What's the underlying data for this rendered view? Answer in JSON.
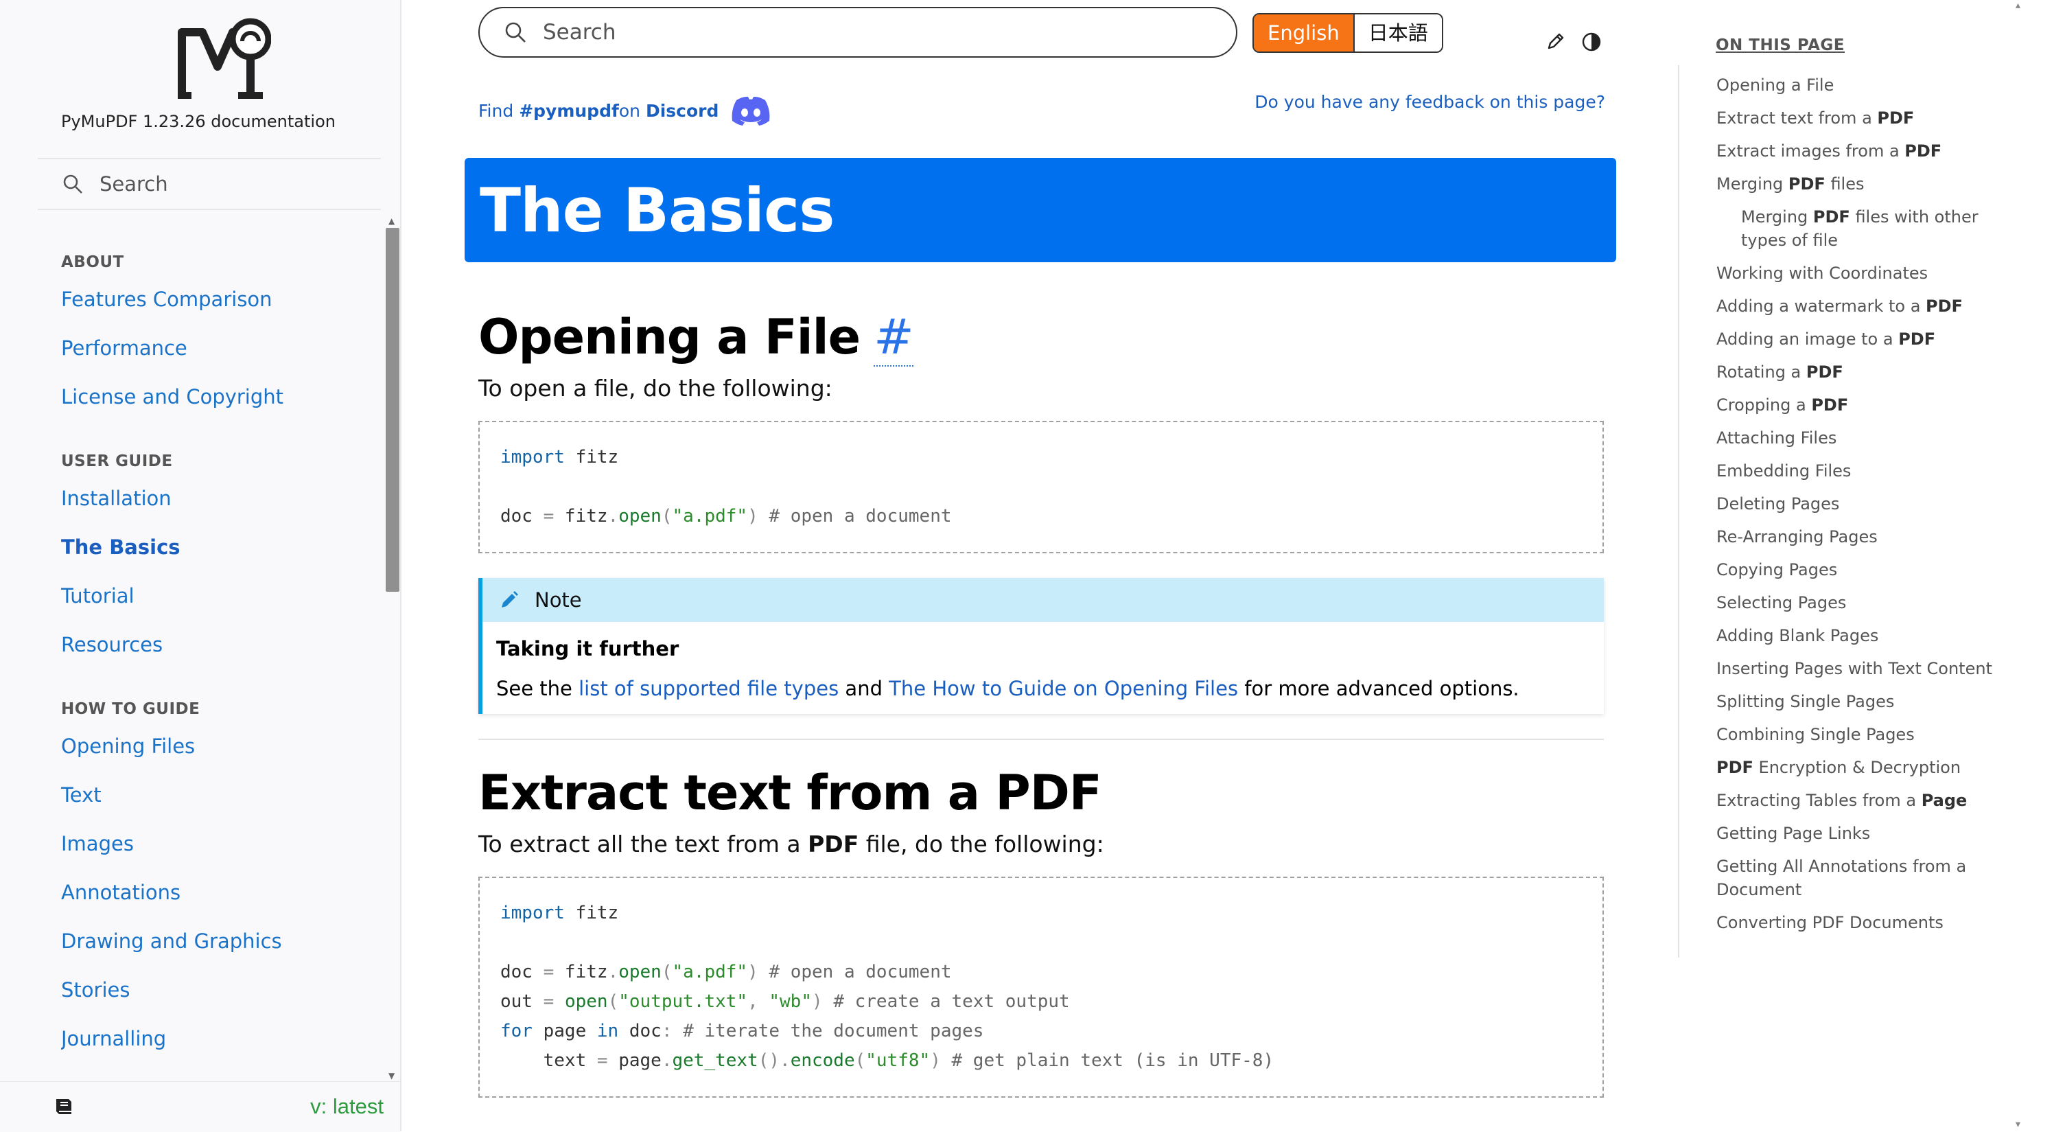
{
  "sidebar": {
    "project_title": "PyMuPDF 1.23.26 documentation",
    "search_placeholder": "Search",
    "sections": [
      {
        "caption": "ABOUT",
        "items": [
          "Features Comparison",
          "Performance",
          "License and Copyright"
        ]
      },
      {
        "caption": "USER GUIDE",
        "items": [
          "Installation",
          "The Basics",
          "Tutorial",
          "Resources"
        ]
      },
      {
        "caption": "HOW TO GUIDE",
        "items": [
          "Opening Files",
          "Text",
          "Images",
          "Annotations",
          "Drawing and Graphics",
          "Stories",
          "Journalling"
        ]
      }
    ],
    "current_item": "The Basics",
    "version_label": "v: latest"
  },
  "topbar": {
    "search_placeholder": "Search",
    "lang_en": "English",
    "lang_ja": "日本語",
    "icons": {
      "edit": "pencil-icon",
      "theme": "theme-toggle-icon"
    }
  },
  "discord": {
    "prefix": "Find ",
    "channel": "#pymupdf",
    "middle": " on ",
    "brand": "Discord"
  },
  "feedback_label": "Do you have any feedback on this page?",
  "article": {
    "title": "The Basics",
    "sections": [
      {
        "heading": "Opening a File",
        "anchor": "#",
        "intro": "To open a file, do the following:",
        "code": [
          [
            {
              "t": "import",
              "c": "kw"
            },
            {
              "t": " fitz",
              "c": ""
            }
          ],
          [],
          [
            {
              "t": "doc ",
              "c": ""
            },
            {
              "t": "=",
              "c": "op"
            },
            {
              "t": " fitz",
              "c": ""
            },
            {
              "t": ".",
              "c": "op"
            },
            {
              "t": "open",
              "c": "fn"
            },
            {
              "t": "(",
              "c": "op"
            },
            {
              "t": "\"a.pdf\"",
              "c": "str"
            },
            {
              "t": ") ",
              "c": "op"
            },
            {
              "t": "# open a document",
              "c": "cm"
            }
          ]
        ]
      },
      {
        "heading": "Extract text from a PDF",
        "intro_pre": "To extract all the text from a ",
        "intro_bold": "PDF",
        "intro_post": " file, do the following:",
        "code": [
          [
            {
              "t": "import",
              "c": "kw"
            },
            {
              "t": " fitz",
              "c": ""
            }
          ],
          [],
          [
            {
              "t": "doc ",
              "c": ""
            },
            {
              "t": "=",
              "c": "op"
            },
            {
              "t": " fitz",
              "c": ""
            },
            {
              "t": ".",
              "c": "op"
            },
            {
              "t": "open",
              "c": "fn"
            },
            {
              "t": "(",
              "c": "op"
            },
            {
              "t": "\"a.pdf\"",
              "c": "str"
            },
            {
              "t": ") ",
              "c": "op"
            },
            {
              "t": "# open a document",
              "c": "cm"
            }
          ],
          [
            {
              "t": "out ",
              "c": ""
            },
            {
              "t": "=",
              "c": "op"
            },
            {
              "t": " ",
              "c": ""
            },
            {
              "t": "open",
              "c": "fn"
            },
            {
              "t": "(",
              "c": "op"
            },
            {
              "t": "\"output.txt\"",
              "c": "str"
            },
            {
              "t": ", ",
              "c": "op"
            },
            {
              "t": "\"wb\"",
              "c": "str"
            },
            {
              "t": ") ",
              "c": "op"
            },
            {
              "t": "# create a text output",
              "c": "cm"
            }
          ],
          [
            {
              "t": "for",
              "c": "kw"
            },
            {
              "t": " page ",
              "c": ""
            },
            {
              "t": "in",
              "c": "kw"
            },
            {
              "t": " doc",
              "c": ""
            },
            {
              "t": ": ",
              "c": "op"
            },
            {
              "t": "# iterate the document pages",
              "c": "cm"
            }
          ],
          [
            {
              "t": "    text ",
              "c": ""
            },
            {
              "t": "=",
              "c": "op"
            },
            {
              "t": " page",
              "c": ""
            },
            {
              "t": ".",
              "c": "op"
            },
            {
              "t": "get_text",
              "c": "fn"
            },
            {
              "t": "()",
              "c": "op"
            },
            {
              "t": ".",
              "c": "op"
            },
            {
              "t": "encode",
              "c": "fn"
            },
            {
              "t": "(",
              "c": "op"
            },
            {
              "t": "\"utf8\"",
              "c": "str"
            },
            {
              "t": ") ",
              "c": "op"
            },
            {
              "t": "# get plain text (is in UTF-8)",
              "c": "cm"
            }
          ]
        ]
      }
    ],
    "note": {
      "label": "Note",
      "subtitle": "Taking it further",
      "text_pre": "See the ",
      "link1": "list of supported file types",
      "text_mid": " and ",
      "link2": "The How to Guide on Opening Files",
      "text_post": " for more advanced options."
    }
  },
  "toc": {
    "title": "ON THIS PAGE",
    "items": [
      {
        "parts": [
          {
            "t": "Opening a File"
          }
        ]
      },
      {
        "parts": [
          {
            "t": "Extract text from a "
          },
          {
            "t": "PDF",
            "b": true
          }
        ]
      },
      {
        "parts": [
          {
            "t": "Extract images from a "
          },
          {
            "t": "PDF",
            "b": true
          }
        ]
      },
      {
        "parts": [
          {
            "t": "Merging "
          },
          {
            "t": "PDF",
            "b": true
          },
          {
            "t": " files"
          }
        ]
      },
      {
        "sub": true,
        "parts": [
          {
            "t": "Merging "
          },
          {
            "t": "PDF",
            "b": true
          },
          {
            "t": " files with other types of file"
          }
        ]
      },
      {
        "parts": [
          {
            "t": "Working with Coordinates"
          }
        ]
      },
      {
        "parts": [
          {
            "t": "Adding a watermark to a "
          },
          {
            "t": "PDF",
            "b": true
          }
        ]
      },
      {
        "parts": [
          {
            "t": "Adding an image to a "
          },
          {
            "t": "PDF",
            "b": true
          }
        ]
      },
      {
        "parts": [
          {
            "t": "Rotating a "
          },
          {
            "t": "PDF",
            "b": true
          }
        ]
      },
      {
        "parts": [
          {
            "t": "Cropping a "
          },
          {
            "t": "PDF",
            "b": true
          }
        ]
      },
      {
        "parts": [
          {
            "t": "Attaching Files"
          }
        ]
      },
      {
        "parts": [
          {
            "t": "Embedding Files"
          }
        ]
      },
      {
        "parts": [
          {
            "t": "Deleting Pages"
          }
        ]
      },
      {
        "parts": [
          {
            "t": "Re-Arranging Pages"
          }
        ]
      },
      {
        "parts": [
          {
            "t": "Copying Pages"
          }
        ]
      },
      {
        "parts": [
          {
            "t": "Selecting Pages"
          }
        ]
      },
      {
        "parts": [
          {
            "t": "Adding Blank Pages"
          }
        ]
      },
      {
        "parts": [
          {
            "t": "Inserting Pages with Text Content"
          }
        ]
      },
      {
        "parts": [
          {
            "t": "Splitting Single Pages"
          }
        ]
      },
      {
        "parts": [
          {
            "t": "Combining Single Pages"
          }
        ]
      },
      {
        "parts": [
          {
            "t": "PDF",
            "b": true
          },
          {
            "t": " Encryption & Decryption"
          }
        ]
      },
      {
        "parts": [
          {
            "t": "Extracting Tables from a "
          },
          {
            "t": "Page",
            "b": true
          }
        ]
      },
      {
        "parts": [
          {
            "t": "Getting Page Links"
          }
        ]
      },
      {
        "parts": [
          {
            "t": "Getting All Annotations from a Document"
          }
        ]
      },
      {
        "parts": [
          {
            "t": "Converting PDF Documents"
          }
        ]
      }
    ]
  },
  "colors": {
    "banner": "#0070ee",
    "link": "#1a73c8",
    "lang_active": "#f77416",
    "note_header": "#c9ecfb",
    "note_accent": "#0a9ee6",
    "version": "#2e9a3f"
  }
}
